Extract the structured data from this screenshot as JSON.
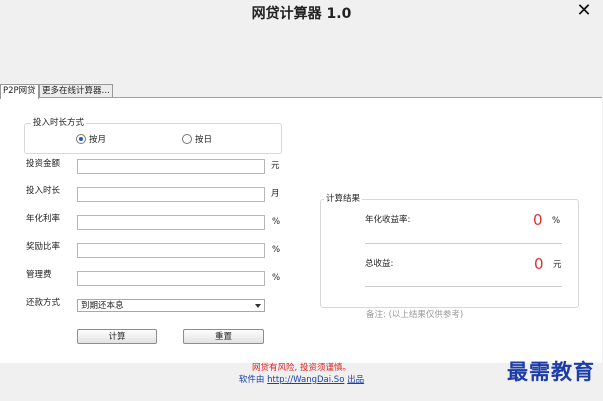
{
  "window": {
    "title": "网贷计算器 1.0",
    "close_glyph": "✕"
  },
  "tabs": [
    {
      "label": "P2P网贷"
    },
    {
      "label": "更多在线计算器…"
    }
  ],
  "invest_period_group": {
    "label": "投入时长方式",
    "option_month": "按月",
    "option_day": "按日",
    "selected": "按月"
  },
  "form": {
    "amount_label": "投资金额",
    "amount_value": "",
    "amount_unit": "元",
    "period_label": "投入时长",
    "period_value": "",
    "period_unit": "月",
    "rate_label": "年化利率",
    "rate_value": "",
    "rate_unit": "%",
    "bonus_label": "奖励比率",
    "bonus_value": "",
    "bonus_unit": "%",
    "fee_label": "管理费",
    "fee_value": "",
    "fee_unit": "%",
    "repay_label": "还款方式",
    "repay_selected": "到期还本息"
  },
  "buttons": {
    "calculate": "计算",
    "reset": "重置"
  },
  "results": {
    "group_label": "计算结果",
    "yield_label": "年化收益率:",
    "yield_value": "0",
    "yield_unit": "%",
    "total_label": "总收益:",
    "total_value": "0",
    "total_unit": "元",
    "note": "备注: (以上结果仅供参考)"
  },
  "footer": {
    "warning": "网贷有风险, 投资须谨慎。",
    "credit_prefix": "软件由",
    "credit_link": "http://WangDai.So",
    "credit_suffix": "出品"
  },
  "watermark": "最需教育",
  "colors": {
    "accent_red": "#e03030",
    "link_blue": "#1a3fb0"
  }
}
